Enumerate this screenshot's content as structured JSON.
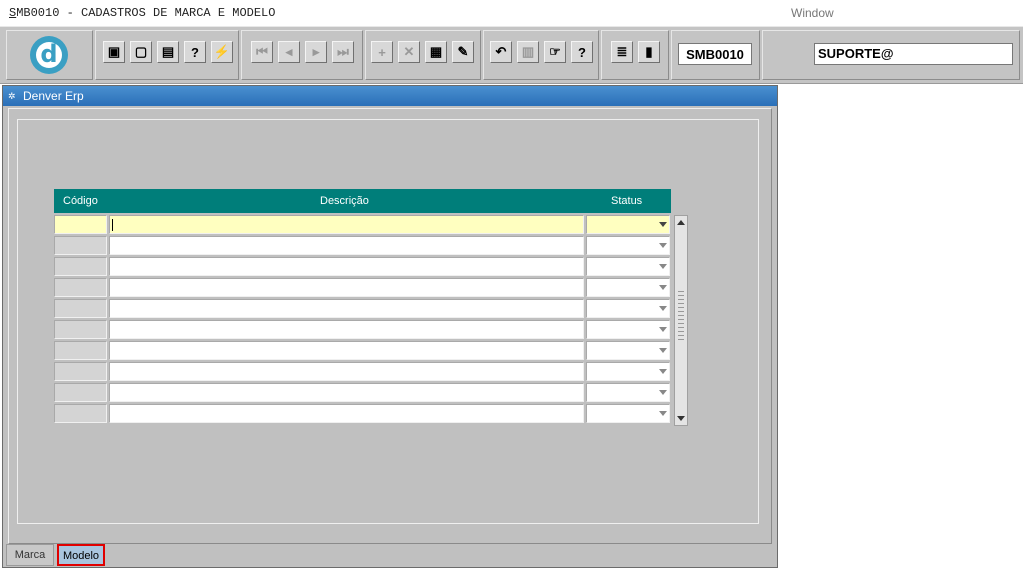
{
  "menubar": {
    "title_first": "S",
    "title_rest": "MB0010 - CADASTROS DE MARCA E MODELO",
    "window_menu": "Window"
  },
  "toolbar": {
    "logo_letter": "d",
    "buttons": [
      {
        "name": "save-icon",
        "glyph": "▣"
      },
      {
        "name": "print-preview-icon",
        "glyph": "▢"
      },
      {
        "name": "print-icon",
        "glyph": "▤"
      },
      {
        "name": "query-help-icon",
        "glyph": "?"
      },
      {
        "name": "execute-query-icon",
        "glyph": "⚡"
      },
      {
        "name": "first-record-icon",
        "glyph": "⏮"
      },
      {
        "name": "previous-record-icon",
        "glyph": "◂"
      },
      {
        "name": "next-record-icon",
        "glyph": "▸"
      },
      {
        "name": "last-record-icon",
        "glyph": "⏭"
      },
      {
        "name": "insert-record-icon",
        "glyph": "+"
      },
      {
        "name": "delete-record-icon",
        "glyph": "✕"
      },
      {
        "name": "clear-record-icon",
        "glyph": "▦"
      },
      {
        "name": "edit-record-icon",
        "glyph": "✎"
      },
      {
        "name": "undo-icon",
        "glyph": "↶"
      },
      {
        "name": "clipboard-icon",
        "glyph": "▥"
      },
      {
        "name": "list-values-icon",
        "glyph": "☞"
      },
      {
        "name": "help-icon",
        "glyph": "?"
      },
      {
        "name": "menu-icon",
        "glyph": "≣"
      },
      {
        "name": "exit-icon",
        "glyph": "▮"
      }
    ],
    "module_code": "SMB0010",
    "user": "SUPORTE@"
  },
  "window": {
    "title": "Denver Erp"
  },
  "grid": {
    "headers": {
      "code": "Código",
      "description": "Descrição",
      "status": "Status"
    },
    "rows": [
      {
        "code": "",
        "description": "",
        "status": ""
      },
      {
        "code": "",
        "description": "",
        "status": ""
      },
      {
        "code": "",
        "description": "",
        "status": ""
      },
      {
        "code": "",
        "description": "",
        "status": ""
      },
      {
        "code": "",
        "description": "",
        "status": ""
      },
      {
        "code": "",
        "description": "",
        "status": ""
      },
      {
        "code": "",
        "description": "",
        "status": ""
      },
      {
        "code": "",
        "description": "",
        "status": ""
      },
      {
        "code": "",
        "description": "",
        "status": ""
      },
      {
        "code": "",
        "description": "",
        "status": ""
      }
    ]
  },
  "tabs": {
    "marca": "Marca",
    "modelo": "Modelo",
    "active": "Modelo"
  }
}
